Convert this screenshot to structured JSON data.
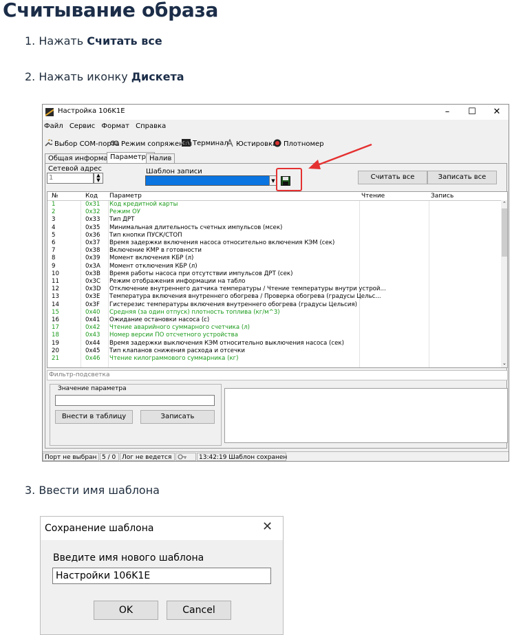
{
  "doc": {
    "title": "Считывание образа",
    "step1_prefix": "1. Нажать ",
    "step1_bold": "Считать все",
    "step2_prefix": "2. Нажать иконку ",
    "step2_bold": "Дискета",
    "step3": "3. Ввести имя шаблона"
  },
  "app": {
    "title": "Настройка 106K1E",
    "menu": [
      "Файл",
      "Сервис",
      "Формат",
      "Справка"
    ],
    "toolbar": {
      "com_port": "Выбор COM-порта",
      "pair_mode": "Режим сопряжения",
      "terminal": "Терминал",
      "calibration": "Юстировка",
      "density": "Плотномер"
    },
    "tabs": [
      "Общая информация",
      "Параметры",
      "Налив"
    ],
    "active_tab": "Параметры",
    "network_address_label": "Сетевой адрес",
    "network_address_value": "1",
    "template_label": "Шаблон записи",
    "read_all_button": "Считать все",
    "write_all_button": "Записать все",
    "columns": [
      "№",
      "Код",
      "Параметр",
      "Чтение",
      "Запись"
    ],
    "rows": [
      {
        "n": "1",
        "code": "0x31",
        "param": "Код кредитной карты",
        "green": true
      },
      {
        "n": "2",
        "code": "0x32",
        "param": "Режим ОУ",
        "green": true
      },
      {
        "n": "3",
        "code": "0x33",
        "param": "Тип ДРТ",
        "green": false
      },
      {
        "n": "4",
        "code": "0x35",
        "param": "Минимальная длительность счетных импульсов (мсек)",
        "green": false
      },
      {
        "n": "5",
        "code": "0x36",
        "param": "Тип кнопки ПУСК/СТОП",
        "green": false
      },
      {
        "n": "6",
        "code": "0x37",
        "param": "Время задержки включения насоса относительно включения КЭМ (сек)",
        "green": false
      },
      {
        "n": "7",
        "code": "0x38",
        "param": "Включение КМР в готовности",
        "green": false
      },
      {
        "n": "8",
        "code": "0x39",
        "param": "Момент включения КБР (л)",
        "green": false
      },
      {
        "n": "9",
        "code": "0x3A",
        "param": "Момент отключения КБР (л)",
        "green": false
      },
      {
        "n": "10",
        "code": "0x3B",
        "param": "Время работы насоса при отсутствии импульсов ДРТ (сек)",
        "green": false
      },
      {
        "n": "11",
        "code": "0x3C",
        "param": "Режим отображения информации на табло",
        "green": false
      },
      {
        "n": "12",
        "code": "0x3D",
        "param": "Отключение внутреннего датчика температуры / Чтение температуры внутри устрой...",
        "green": false
      },
      {
        "n": "13",
        "code": "0x3E",
        "param": "Температура включения внутреннего обогрева / Проверка обогрева (градусы Цельс...",
        "green": false
      },
      {
        "n": "14",
        "code": "0x3F",
        "param": "Гистерезис температуры включения внутреннего обогрева (градусы Цельсия)",
        "green": false
      },
      {
        "n": "15",
        "code": "0x40",
        "param": "Средняя (за один отпуск) плотность топлива (кг/м^3)",
        "green": true
      },
      {
        "n": "16",
        "code": "0x41",
        "param": "Ожидание остановки насоса (с)",
        "green": false
      },
      {
        "n": "17",
        "code": "0x42",
        "param": "Чтение аварийного суммарного счетчика (л)",
        "green": true
      },
      {
        "n": "18",
        "code": "0x43",
        "param": "Номер версии ПО отсчетного устройства",
        "green": true
      },
      {
        "n": "19",
        "code": "0x44",
        "param": "Время задержки выключения КЭМ относительно выключения насоса (сек)",
        "green": false
      },
      {
        "n": "20",
        "code": "0x45",
        "param": "Тип клапанов снижения расхода и отсечки",
        "green": false
      },
      {
        "n": "21",
        "code": "0x46",
        "param": "Чтение килограммового суммарника (кг)",
        "green": true
      }
    ],
    "filter_placeholder": "Фильтр-подсветка",
    "param_value_label": "Значение параметра",
    "enter_to_table_button": "Внести в таблицу",
    "write_button": "Записать",
    "status": {
      "port": "Порт не выбран",
      "counter": "5 / 0",
      "log": "Лог не ведется",
      "message": "13:42:19 Шаблон сохранен"
    },
    "colors": {
      "green_text": "#1a9a1a",
      "combo_blue": "#0a74e0",
      "highlight_red": "#e53030"
    }
  },
  "dialog": {
    "title": "Сохранение шаблона",
    "prompt": "Введите имя нового шаблона",
    "input_value": "Настройки 106K1E",
    "ok": "OK",
    "cancel": "Cancel"
  }
}
